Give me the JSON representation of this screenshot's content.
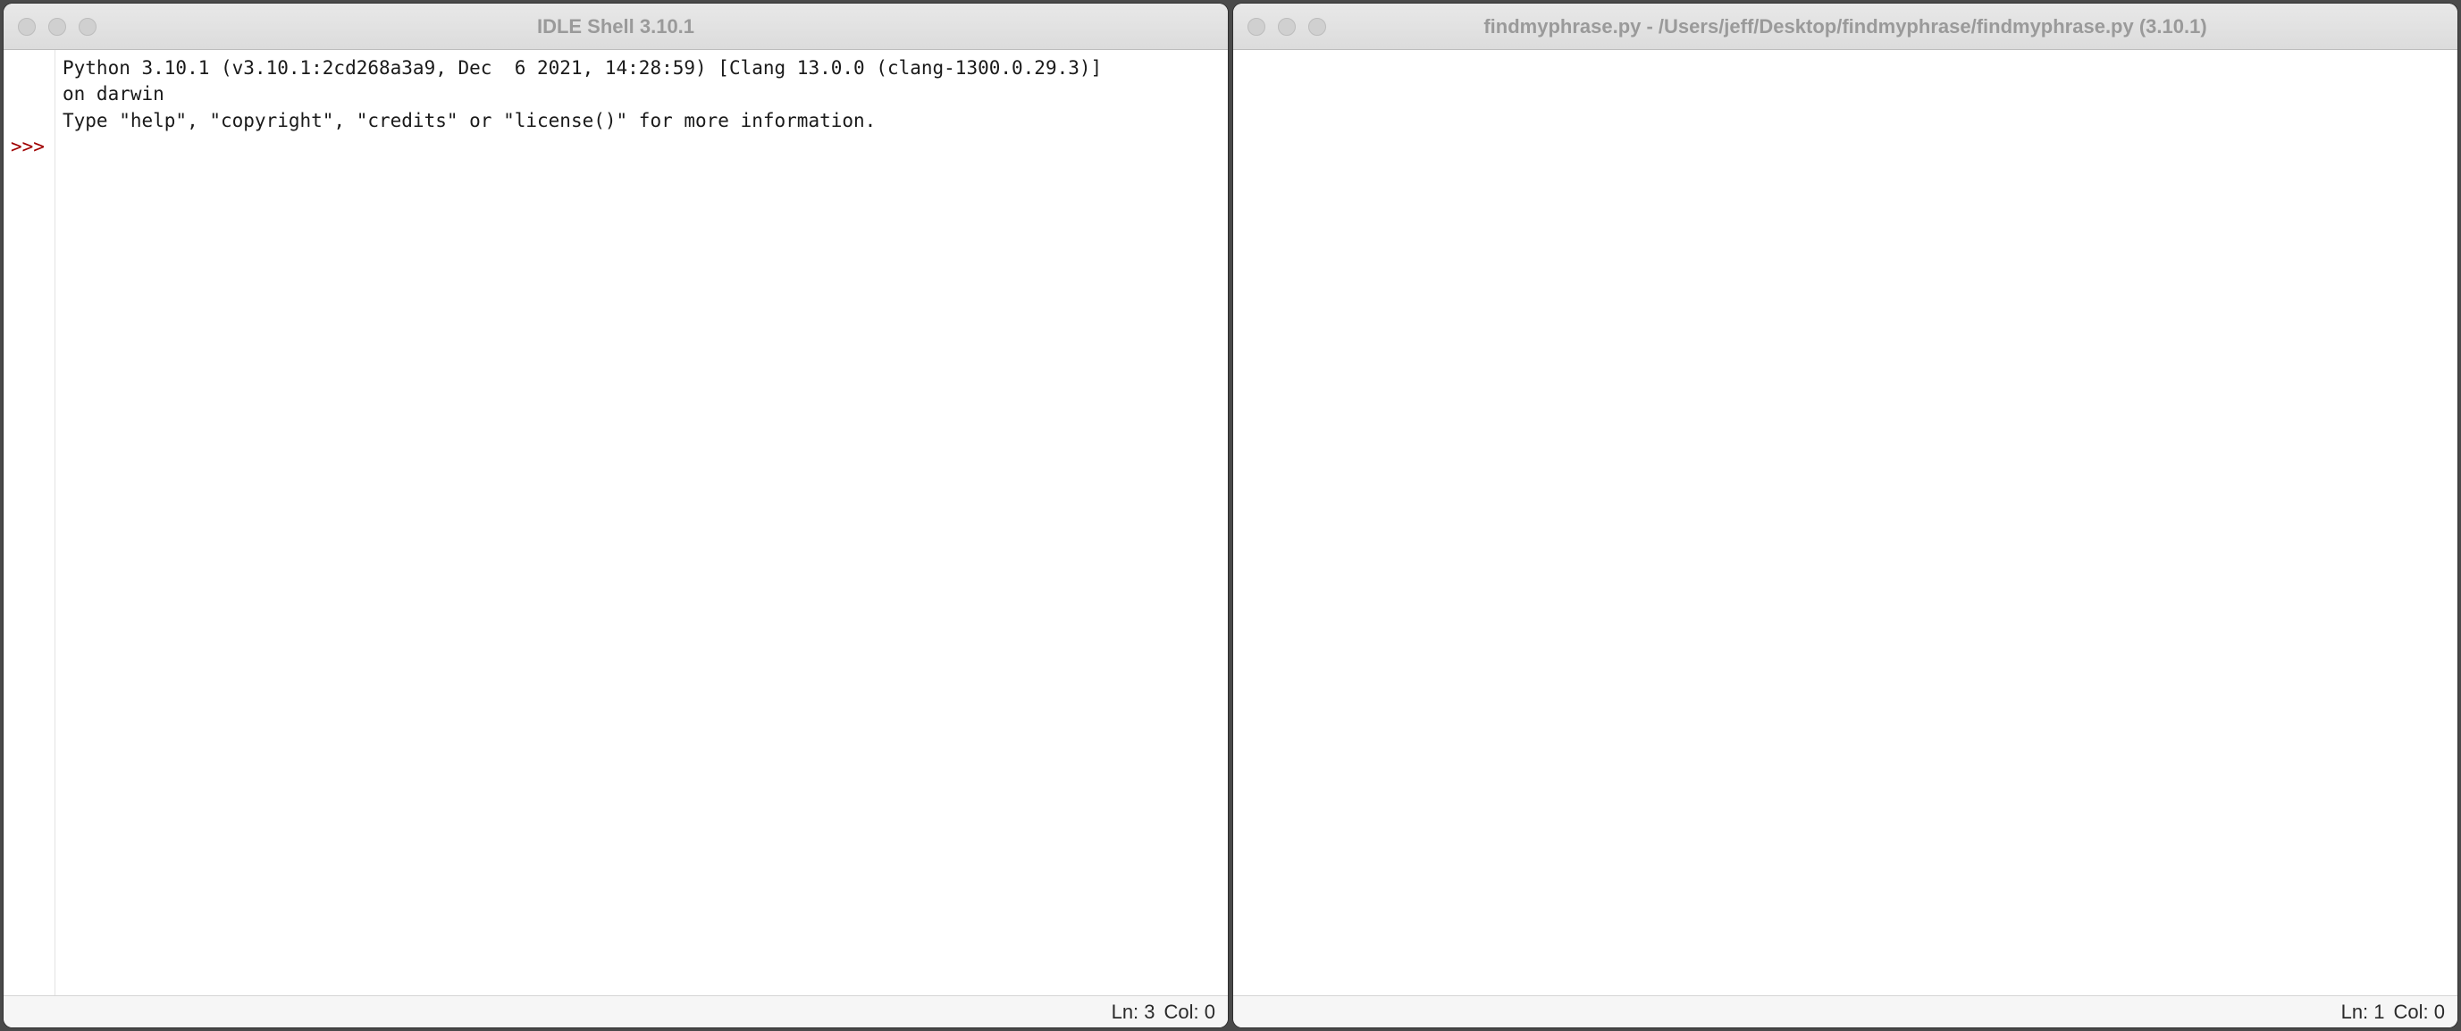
{
  "windows": {
    "shell": {
      "title": "IDLE Shell 3.10.1",
      "banner_line1": "Python 3.10.1 (v3.10.1:2cd268a3a9, Dec  6 2021, 14:28:59) [Clang 13.0.0 (clang-1300.0.29.3)]",
      "banner_line2": "on darwin",
      "banner_line3": "Type \"help\", \"copyright\", \"credits\" or \"license()\" for more information.",
      "prompt": ">>>",
      "status_line": "Ln: 3",
      "status_col": "Col: 0"
    },
    "editor": {
      "title": "findmyphrase.py - /Users/jeff/Desktop/findmyphrase/findmyphrase.py (3.10.1)",
      "content": "",
      "status_line": "Ln: 1",
      "status_col": "Col: 0"
    }
  }
}
